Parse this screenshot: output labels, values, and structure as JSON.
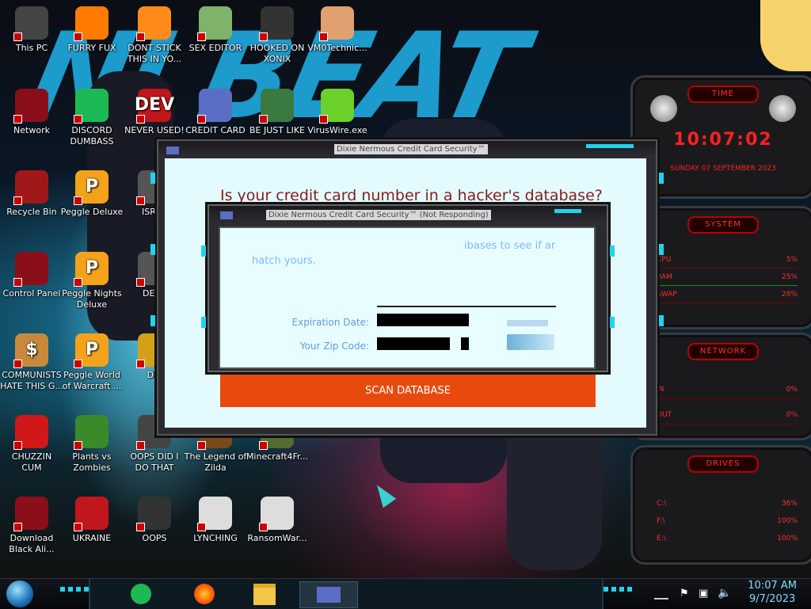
{
  "desktop_icons": [
    {
      "id": "this-pc",
      "label": "This PC",
      "color": "#444"
    },
    {
      "id": "furry-fux",
      "label": "FURRY FUX",
      "color": "#ff7a00"
    },
    {
      "id": "dont-stick",
      "label": "DONT STICK\nTHIS IN YO...",
      "color": "#ff8c1a"
    },
    {
      "id": "sex-editor",
      "label": "SEX EDITOR",
      "color": "#7fb36a"
    },
    {
      "id": "hooked-on-xonix",
      "label": "HOOKED ON\nXONIX",
      "color": "#333"
    },
    {
      "id": "vm0technic",
      "label": "VM0Technic...",
      "color": "#e0a070"
    },
    {
      "id": "network",
      "label": "Network",
      "color": "#8a0f1a"
    },
    {
      "id": "discord-dumbass",
      "label": "DISCORD\nDUMBASS",
      "color": "#1db954"
    },
    {
      "id": "never-used",
      "label": "NEVER USED!",
      "color": "#c0161c",
      "glyph": "DEV"
    },
    {
      "id": "credit-card",
      "label": "CREDIT CARD",
      "color": "#5b6ec5"
    },
    {
      "id": "be-just-like",
      "label": "BE JUST LIKE",
      "color": "#3a7a40"
    },
    {
      "id": "viruswire",
      "label": "VirusWire.exe",
      "color": "#6cd02a"
    },
    {
      "id": "recycle-bin",
      "label": "Recycle Bin",
      "color": "#a01818"
    },
    {
      "id": "peggle-deluxe",
      "label": "Peggle Deluxe",
      "color": "#f3a21a",
      "glyph": "P"
    },
    {
      "id": "israel",
      "label": "ISRAE",
      "color": "#555"
    },
    {
      "id": "control-panel",
      "label": "Control Panel",
      "color": "#8a0f1a"
    },
    {
      "id": "peggle-nights",
      "label": "Peggle Nights\nDeluxe",
      "color": "#f3a21a",
      "glyph": "P"
    },
    {
      "id": "deez",
      "label": "DEEZ",
      "color": "#555"
    },
    {
      "id": "communists",
      "label": "COMMUNISTS\nHATE THIS G...",
      "color": "#c88a3a",
      "glyph": "$"
    },
    {
      "id": "peggle-wow",
      "label": "Peggle World\nof Warcraft ...",
      "color": "#f3a21a",
      "glyph": "P"
    },
    {
      "id": "die",
      "label": "DIE",
      "color": "#d4a017"
    },
    {
      "id": "chuzzin",
      "label": "CHUZZIN\nCUM",
      "color": "#d01818"
    },
    {
      "id": "pvz",
      "label": "Plants vs\nZombies",
      "color": "#3a8a2a"
    },
    {
      "id": "oops-did",
      "label": "OOPS DID I\nDO THAT",
      "color": "#444"
    },
    {
      "id": "zilda",
      "label": "The Legend of\nZilda",
      "color": "#7a4a1a"
    },
    {
      "id": "minecraft",
      "label": "Minecraft4Fr...",
      "color": "#556b2f"
    },
    {
      "id": "black-ali",
      "label": "Download\nBlack Ali...",
      "color": "#8a0f1a"
    },
    {
      "id": "ukraine",
      "label": "UKRAINE",
      "color": "#c0161c"
    },
    {
      "id": "oops",
      "label": "OOPS",
      "color": "#333"
    },
    {
      "id": "lynching",
      "label": "LYNCHING",
      "color": "#ddd"
    },
    {
      "id": "ransomware",
      "label": "RansomWar...",
      "color": "#ddd"
    }
  ],
  "widgets": {
    "time": {
      "title": "TIME",
      "clock": "10:07:02",
      "date": "SUNDAY 07 SEPTEMBER 2023"
    },
    "system": {
      "title": "SYSTEM",
      "rows": [
        {
          "label": "CPU",
          "value": "5%"
        },
        {
          "label": "RAM",
          "value": "25%"
        },
        {
          "label": "SWAP",
          "value": "28%"
        }
      ]
    },
    "network": {
      "title": "NETWORK",
      "rows": [
        {
          "label": "IN",
          "value": "0%"
        },
        {
          "label": "OUT",
          "value": "0%"
        }
      ]
    },
    "drives": {
      "title": "DRIVES",
      "rows": [
        {
          "label": "C:\\",
          "value": "36%"
        },
        {
          "label": "F:\\",
          "value": "100%"
        },
        {
          "label": "E:\\",
          "value": "100%"
        }
      ]
    }
  },
  "back_window": {
    "title": "Dixie Nermous Credit Card Security™",
    "headline": "Is your credit card number in a hacker's database?",
    "scan_label": "SCAN DATABASE"
  },
  "front_window": {
    "title": "Dixie Nermous Credit Card Security™ (Not Responding)",
    "body_text_right": "ibases to see if ar",
    "body_text_left": "hatch yours.",
    "expiration_label": "Expiration Date:",
    "zip_label": "Your Zip Code:"
  },
  "taskbar": {
    "time": "10:07 AM",
    "date": "9/7/2023"
  }
}
